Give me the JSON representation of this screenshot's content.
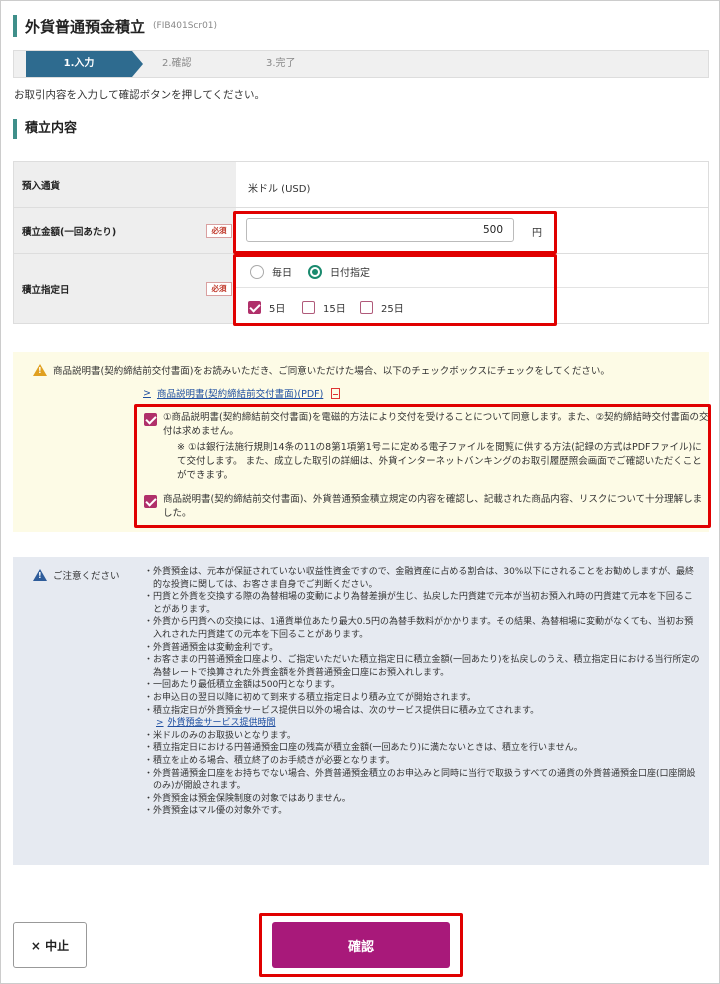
{
  "page": {
    "title": "外貨普通預金積立",
    "screen_code": "(FIB401Scr01)"
  },
  "steps": [
    {
      "label": "1.入力"
    },
    {
      "label": "2.確認"
    },
    {
      "label": "3.完了"
    }
  ],
  "instruction": "お取引内容を入力して確認ボタンを押してください。",
  "section": {
    "title": "積立内容"
  },
  "form": {
    "currency": {
      "label": "預入通貨",
      "value": "米ドル (USD)"
    },
    "amount": {
      "label": "積立金額(一回あたり)",
      "required": "必須",
      "value": "500",
      "unit": "円"
    },
    "date": {
      "label": "積立指定日",
      "required": "必須",
      "options": [
        "毎日",
        "日付指定"
      ],
      "selected": "日付指定",
      "days": [
        {
          "label": "5日",
          "checked": true
        },
        {
          "label": "15日",
          "checked": false
        },
        {
          "label": "25日",
          "checked": false
        }
      ]
    }
  },
  "notice": {
    "lead": "商品説明書(契約締結前交付書面)をお読みいただき、ご同意いただけた場合、以下のチェックボックスにチェックをしてください。",
    "pdf_link": "商品説明書(契約締結前交付書面)(PDF)",
    "agree1": "①商品説明書(契約締結前交付書面)を電磁的方法により交付を受けることについて同意します。また、②契約締結時交付書面の交付は求めません。",
    "agree1_note": "※ ①は銀行法施行規則14条の11の8第1項第1号ニに定める電子ファイルを閲覧に供する方法(記録の方式はPDFファイル)にて交付します。 また、成立した取引の詳細は、外貨インターネットバンキングのお取引履歴照会画面でご確認いただくことができます。",
    "agree2": "商品説明書(契約締結前交付書面)、外貨普通預金積立規定の内容を確認し、記載された商品内容、リスクについて十分理解しました。"
  },
  "caution": {
    "heading": "ご注意ください",
    "items": [
      "・外貨預金は、元本が保証されていない収益性資金ですので、金融資産に占める割合は、30%以下にされることをお勧めしますが、最終的な投資に関しては、お客さま自身でご判断ください。",
      "・円貨と外貨を交換する際の為替相場の変動により為替差損が生じ、払戻した円貨建で元本が当初お預入れ時の円貨建て元本を下回ることがあります。",
      "・外貨から円貨への交換には、1通貨単位あたり最大0.5円の為替手数料がかかります。その結果、為替相場に変動がなくても、当初お預入れされた円貨建ての元本を下回ることがあります。",
      "・外貨普通預金は変動金利です。",
      "・お客さまの円普通預金口座より、ご指定いただいた積立指定日に積立金額(一回あたり)を払戻しのうえ、積立指定日における当行所定の為替レートで換算された外貨金額を外貨普通預金口座にお預入れします。",
      "・一回あたり最低積立金額は500円となります。",
      "・お申込日の翌日以降に初めて到来する積立指定日より積み立てが開始されます。",
      "・積立指定日が外貨預金サービス提供日以外の場合は、次のサービス提供日に積み立てされます。"
    ],
    "link": "外貨預金サービス提供時間",
    "items2": [
      "・米ドルのみのお取扱いとなります。",
      "・積立指定日における円普通預金口座の残高が積立金額(一回あたり)に満たないときは、積立を行いません。",
      "・積立を止める場合、積立終了のお手続きが必要となります。",
      "・外貨普通預金口座をお持ちでない場合、外貨普通預金積立のお申込みと同時に当行で取扱うすべての通貨の外貨普通預金口座(口座開設のみ)が開設されます。",
      "・外貨預金は預金保険制度の対象ではありません。",
      "・外貨預金はマル優の対象外です。"
    ]
  },
  "buttons": {
    "cancel": "× 中止",
    "confirm": "確認"
  },
  "colors": {
    "teal": "#3f8f8a",
    "step_active": "#2e6b8f",
    "confirm": "#a8197a",
    "checkbox": "#b0306a",
    "highlight": "#e00000"
  }
}
